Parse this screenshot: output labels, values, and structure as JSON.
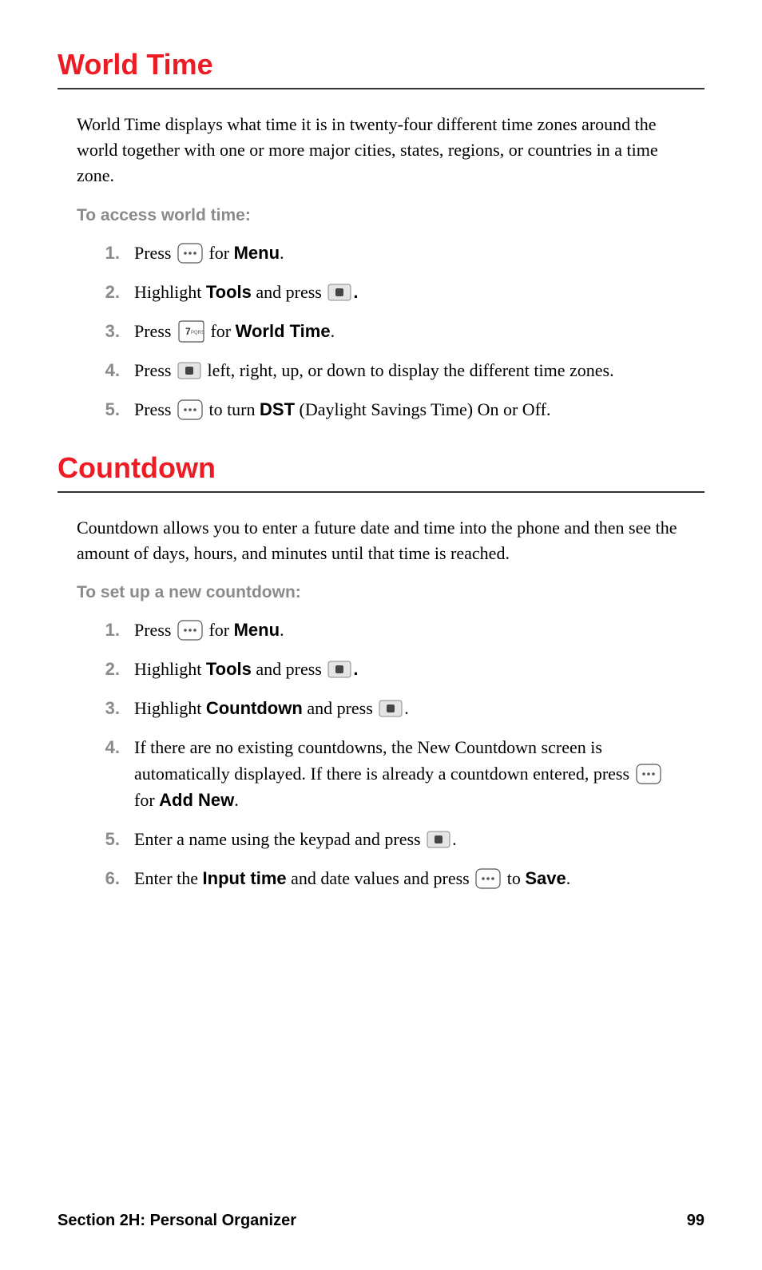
{
  "worldTime": {
    "heading": "World Time",
    "intro": "World Time displays what time it is in twenty-four different time zones around the world together with one or more major cities, states, regions, or countries in a time zone.",
    "subhead": "To access world time:",
    "steps": {
      "s1": {
        "num": "1.",
        "t1": "Press ",
        "b1": "Menu",
        "t2": "."
      },
      "s2": {
        "num": "2.",
        "t1": "Highlight ",
        "b1": "Tools",
        "t2": " and press ",
        "t3": "."
      },
      "s3": {
        "num": "3.",
        "t1": "Press ",
        "b1": "World Time",
        "t2": "."
      },
      "s4": {
        "num": "4.",
        "t1": "Press ",
        "t2": " left, right, up, or down to display the different time zones."
      },
      "s5": {
        "num": "5.",
        "t1": "Press ",
        "t2": " to turn ",
        "b1": "DST",
        "t3": " (Daylight Savings Time) On or Off."
      }
    }
  },
  "countdown": {
    "heading": "Countdown",
    "intro": "Countdown allows you to enter a future date and time into the phone and then see the amount of days, hours, and minutes until that time is reached.",
    "subhead": "To set up a new countdown:",
    "steps": {
      "s1": {
        "num": "1.",
        "t1": "Press ",
        "b1": "Menu",
        "t2": "."
      },
      "s2": {
        "num": "2.",
        "t1": "Highlight ",
        "b1": "Tools",
        "t2": " and press ",
        "t3": "."
      },
      "s3": {
        "num": "3.",
        "t1": "Highlight ",
        "b1": "Countdown",
        "t2": " and press ",
        "t3": "."
      },
      "s4": {
        "num": "4.",
        "t1": "If there are no existing countdowns, the New Countdown screen is automatically displayed. If there is already a countdown entered, press ",
        "b1": "Add New",
        "t2": "."
      },
      "s5": {
        "num": "5.",
        "t1": "Enter a name using the keypad and press ",
        "t2": "."
      },
      "s6": {
        "num": "6.",
        "t1": "Enter the ",
        "b1": "Input time",
        "t2": " and date values and press ",
        "b2": "Save",
        "t3": "."
      }
    }
  },
  "footer": {
    "section": "Section 2H: Personal Organizer",
    "page": "99"
  },
  "forText": " for "
}
